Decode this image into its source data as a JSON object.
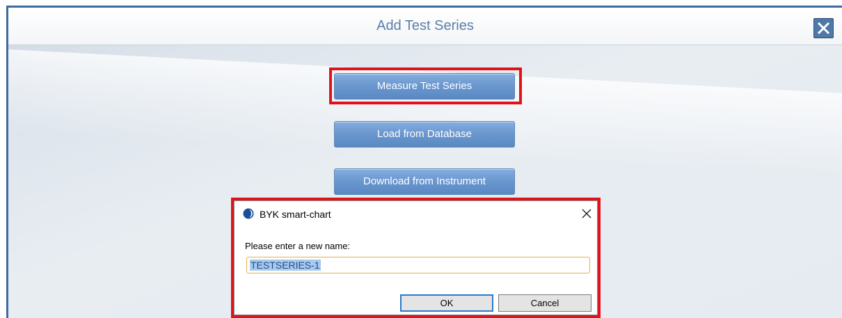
{
  "dialog": {
    "title": "Add Test Series",
    "close_icon": "close-icon"
  },
  "actions": {
    "measure_label": "Measure Test Series",
    "load_label": "Load from Database",
    "download_label": "Download from Instrument"
  },
  "popup": {
    "title": "BYK smart-chart",
    "logo_icon": "byk-logo-icon",
    "close_icon": "close-icon",
    "prompt": "Please enter a new name:",
    "name_value": "TESTSERIES-1",
    "ok_label": "OK",
    "cancel_label": "Cancel"
  },
  "colors": {
    "accent": "#5a88c2",
    "highlight_frame": "#e0131b"
  }
}
